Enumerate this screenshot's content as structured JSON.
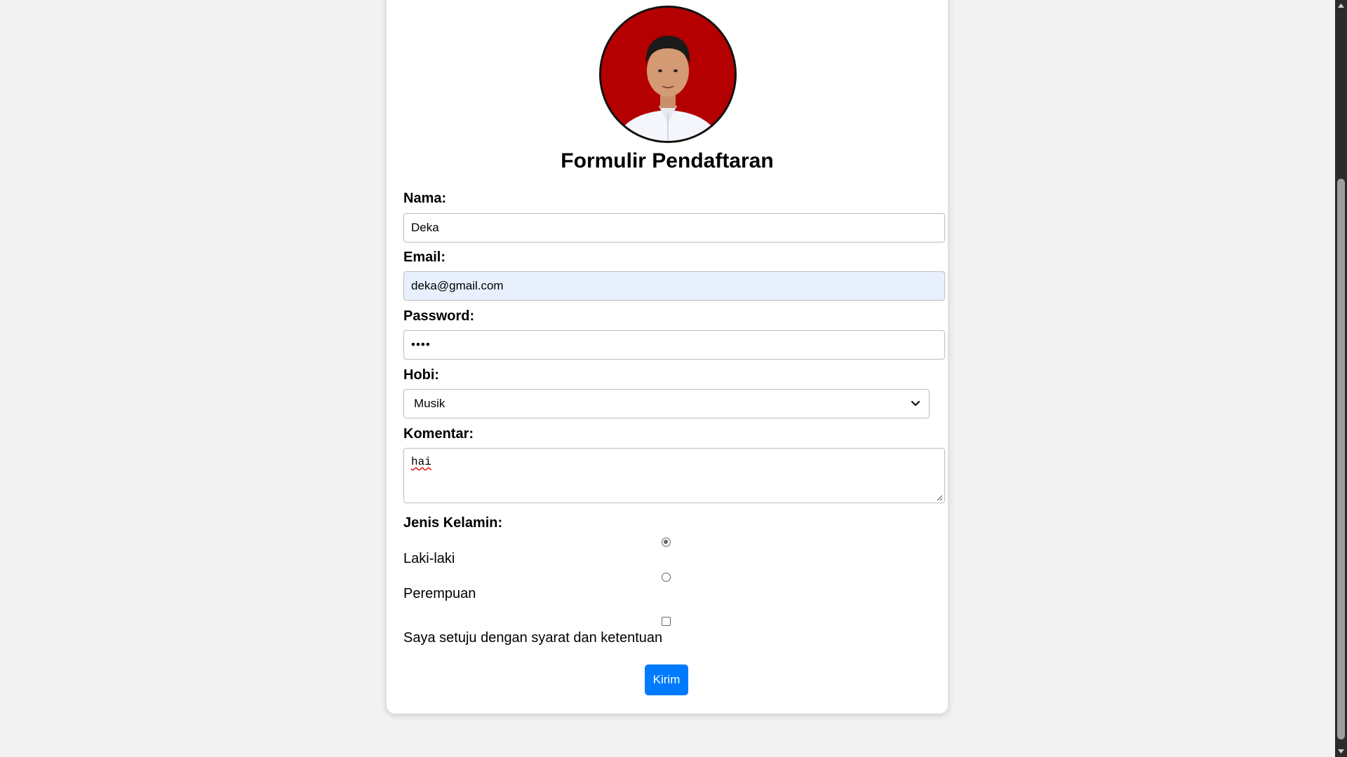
{
  "form": {
    "title": "Formulir Pendaftaran",
    "name_label": "Nama:",
    "name_value": "Deka",
    "email_label": "Email:",
    "email_value": "deka@gmail.com",
    "password_label": "Password:",
    "password_value": "••••",
    "hobby_label": "Hobi:",
    "hobby_selected": "Musik",
    "comment_label": "Komentar:",
    "comment_value": "hai",
    "gender_label": "Jenis Kelamin:",
    "gender_options": [
      "Laki-laki",
      "Perempuan"
    ],
    "gender_selected": "Laki-laki",
    "terms_label": "Saya setuju dengan syarat dan ketentuan",
    "terms_checked": false,
    "submit_label": "Kirim"
  },
  "colors": {
    "page_background": "#f2f2f2",
    "card_background": "#ffffff",
    "submit_button": "#007bff",
    "email_autofill": "#e8f0fe",
    "avatar_background": "#b40000"
  },
  "icons": {
    "dropdown": "chevron-down-icon",
    "resize": "resize-grip-icon"
  }
}
